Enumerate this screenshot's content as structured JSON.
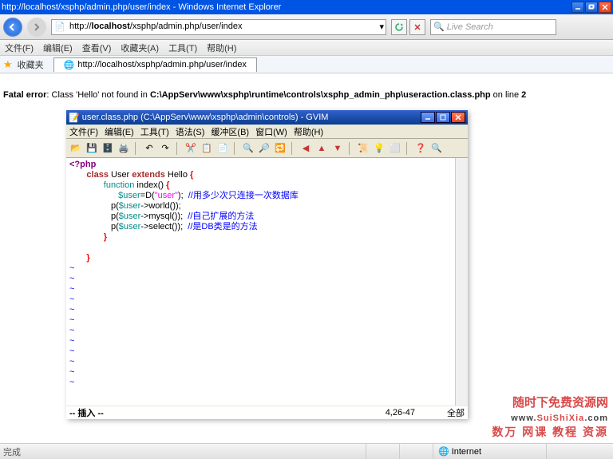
{
  "ie": {
    "title": "http://localhost/xsphp/admin.php/user/index - Windows Internet Explorer",
    "url_host": "localhost",
    "url_prefix": "http://",
    "url_path": "/xsphp/admin.php/user/index",
    "search_placeholder": "Live Search",
    "menubar": [
      "文件(F)",
      "编辑(E)",
      "查看(V)",
      "收藏夹(A)",
      "工具(T)",
      "帮助(H)"
    ],
    "fav_label": "收藏夹",
    "tab_title": "http://localhost/xsphp/admin.php/user/index",
    "status_text": "完成",
    "status_zone": "Internet"
  },
  "error": {
    "prefix": "Fatal error",
    "msg_before": ": Class 'Hello' not found in ",
    "path": "C:\\AppServ\\www\\xsphp\\runtime\\controls\\xsphp_admin_php\\useraction.class.php",
    "msg_online": " on line ",
    "line": "2"
  },
  "gvim": {
    "title": "user.class.php (C:\\AppServ\\www\\xsphp\\admin\\controls) - GVIM",
    "menubar": [
      "文件(F)",
      "编辑(E)",
      "工具(T)",
      "语法(S)",
      "缓冲区(B)",
      "窗口(W)",
      "帮助(H)"
    ],
    "toolbar_icons": [
      "open",
      "save",
      "saveall",
      "print",
      "",
      "undo",
      "redo",
      "",
      "cut",
      "copy",
      "paste",
      "",
      "find",
      "findnext",
      "replace",
      "",
      "ctags-prev",
      "ctags-next",
      "ctags-jump",
      "",
      "shell",
      "make",
      "build",
      "",
      "help",
      "search-help"
    ],
    "status": {
      "mode": "-- 插入 --",
      "pos": "4,26-47",
      "view": "全部"
    },
    "code": {
      "l1": "<?php",
      "l2_pre": "       ",
      "l2_class": "class",
      "l2_user": " User ",
      "l2_ext": "extends",
      "l2_hello": " Hello ",
      "l2_brace": "{",
      "l3_pre": "              ",
      "l3_fn": "function",
      "l3_idx": " index",
      "l3_paren": "()",
      "l3_brace": " {",
      "l4_pre": "                    ",
      "l4_var": "$user",
      "l4_eqD": "=D(",
      "l4_str": "\"user\"",
      "l4_rest": ");  ",
      "l4_com": "//用多少次只连接一次数据库",
      "l5_pre": "                 p(",
      "l5_var": "$user",
      "l5_rest": "->world());",
      "l6_pre": "                 p(",
      "l6_var": "$user",
      "l6_rest": "->mysql());  ",
      "l6_com": "//自己扩展的方法",
      "l7_pre": "                 p(",
      "l7_var": "$user",
      "l7_rest": "->select());  ",
      "l7_com": "//是DB类是的方法",
      "l8_pre": "              ",
      "l8_brace": "}",
      "l9_pre": "       ",
      "l9_brace": "}",
      "tilde": "~"
    }
  },
  "watermark": {
    "line1": "随时下免费资源网",
    "line2a": "www.",
    "line2b": "SuiShiXia",
    "line2c": ".com",
    "line3": "数万 网课 教程 资源"
  }
}
